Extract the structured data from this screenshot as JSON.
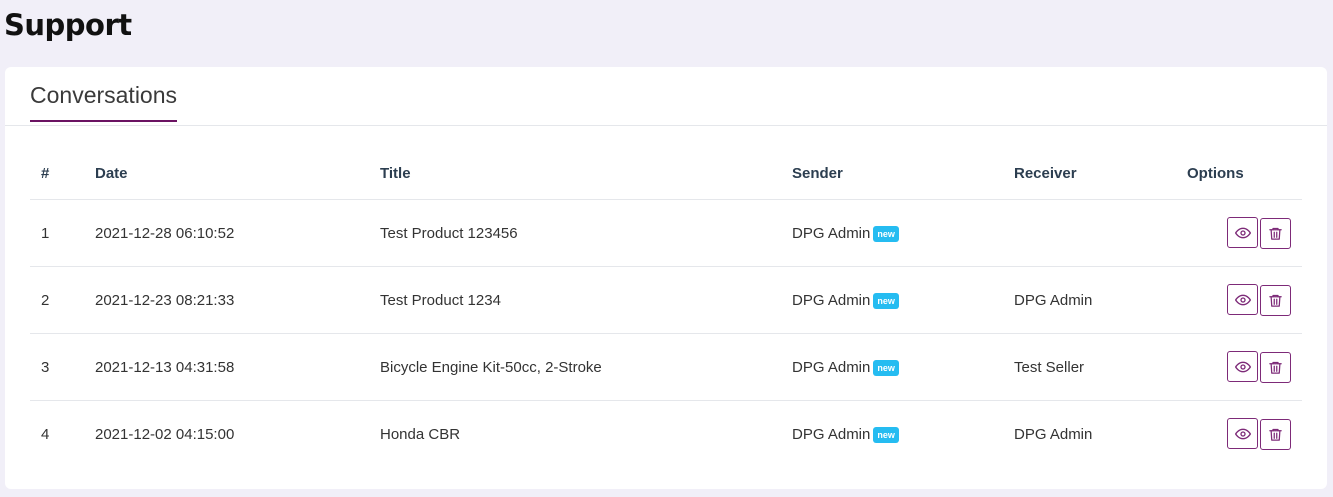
{
  "page": {
    "title": "Support"
  },
  "tabs": [
    {
      "label": "Conversations",
      "active": true
    }
  ],
  "table": {
    "headers": [
      "#",
      "Date",
      "Title",
      "Sender",
      "Receiver",
      "Options"
    ],
    "rows": [
      {
        "num": "1",
        "date": "2021-12-28 06:10:52",
        "title": "Test Product 123456",
        "sender": "DPG Admin",
        "badge": "new",
        "receiver": ""
      },
      {
        "num": "2",
        "date": "2021-12-23 08:21:33",
        "title": "Test Product 1234",
        "sender": "DPG Admin",
        "badge": "new",
        "receiver": "DPG Admin"
      },
      {
        "num": "3",
        "date": "2021-12-13 04:31:58",
        "title": "Bicycle Engine Kit-50cc, 2-Stroke",
        "sender": "DPG Admin",
        "badge": "new",
        "receiver": "Test Seller"
      },
      {
        "num": "4",
        "date": "2021-12-02 04:15:00",
        "title": "Honda CBR",
        "sender": "DPG Admin",
        "badge": "new",
        "receiver": "DPG Admin"
      }
    ],
    "row_actions": [
      {
        "name": "view",
        "icon": "eye-icon"
      },
      {
        "name": "delete",
        "icon": "trash-icon"
      }
    ]
  },
  "colors": {
    "background": "#f1eff8",
    "accent": "#6b1362",
    "badge": "#25bcf1",
    "button_border": "#7d2a78"
  }
}
